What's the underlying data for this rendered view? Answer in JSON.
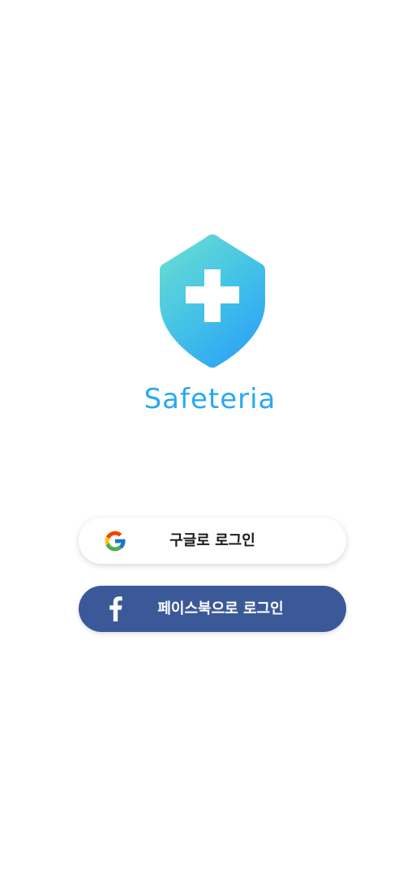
{
  "app": {
    "name": "Safeteria",
    "brand_color": "#2aa8f0",
    "logo_icon": "shield-cross-icon"
  },
  "login": {
    "google": {
      "label": "구글로 로그인",
      "icon": "google-icon",
      "background": "#ffffff"
    },
    "facebook": {
      "label": "페이스북으로 로그인",
      "icon": "facebook-icon",
      "background": "#3b5998"
    }
  }
}
